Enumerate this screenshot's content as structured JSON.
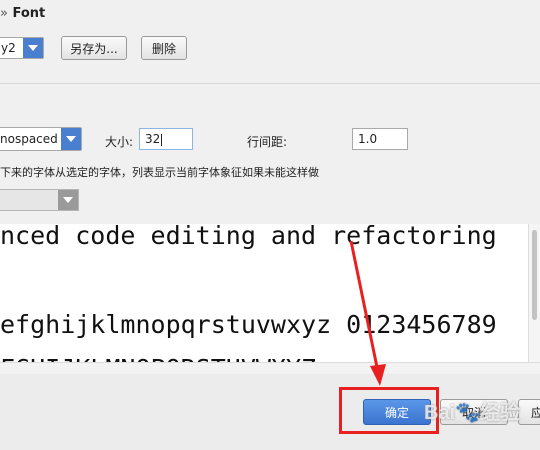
{
  "breadcrumb": {
    "separator": "»",
    "current": "Font"
  },
  "scheme": {
    "selected": "y2",
    "save_as_label": "另存为...",
    "delete_label": "删除"
  },
  "font": {
    "primary_font": "nospaced",
    "size_label": "大小:",
    "size_value": "32",
    "line_spacing_label": "行间距:",
    "line_spacing_value": "1.0",
    "fallback_hint": "下来的字体从选定的字体，列表显示当前字体象征如果未能这样做",
    "fallback_font": ""
  },
  "preview": {
    "line1": "nced code editing and refactoring",
    "line2": "efghijklmnopqrstuvwxyz 0123456789",
    "line3": "FGHIJKLMNOPQRSTUVWXYZ"
  },
  "footer": {
    "ok_label": "确定",
    "cancel_label": "取消",
    "apply_label": "应"
  },
  "annotation": {
    "color": "#e8201f"
  },
  "colors": {
    "accent": "#4a7fd0",
    "ok_button": "#3a74cf"
  },
  "icons": [
    "chevron-down-icon"
  ]
}
